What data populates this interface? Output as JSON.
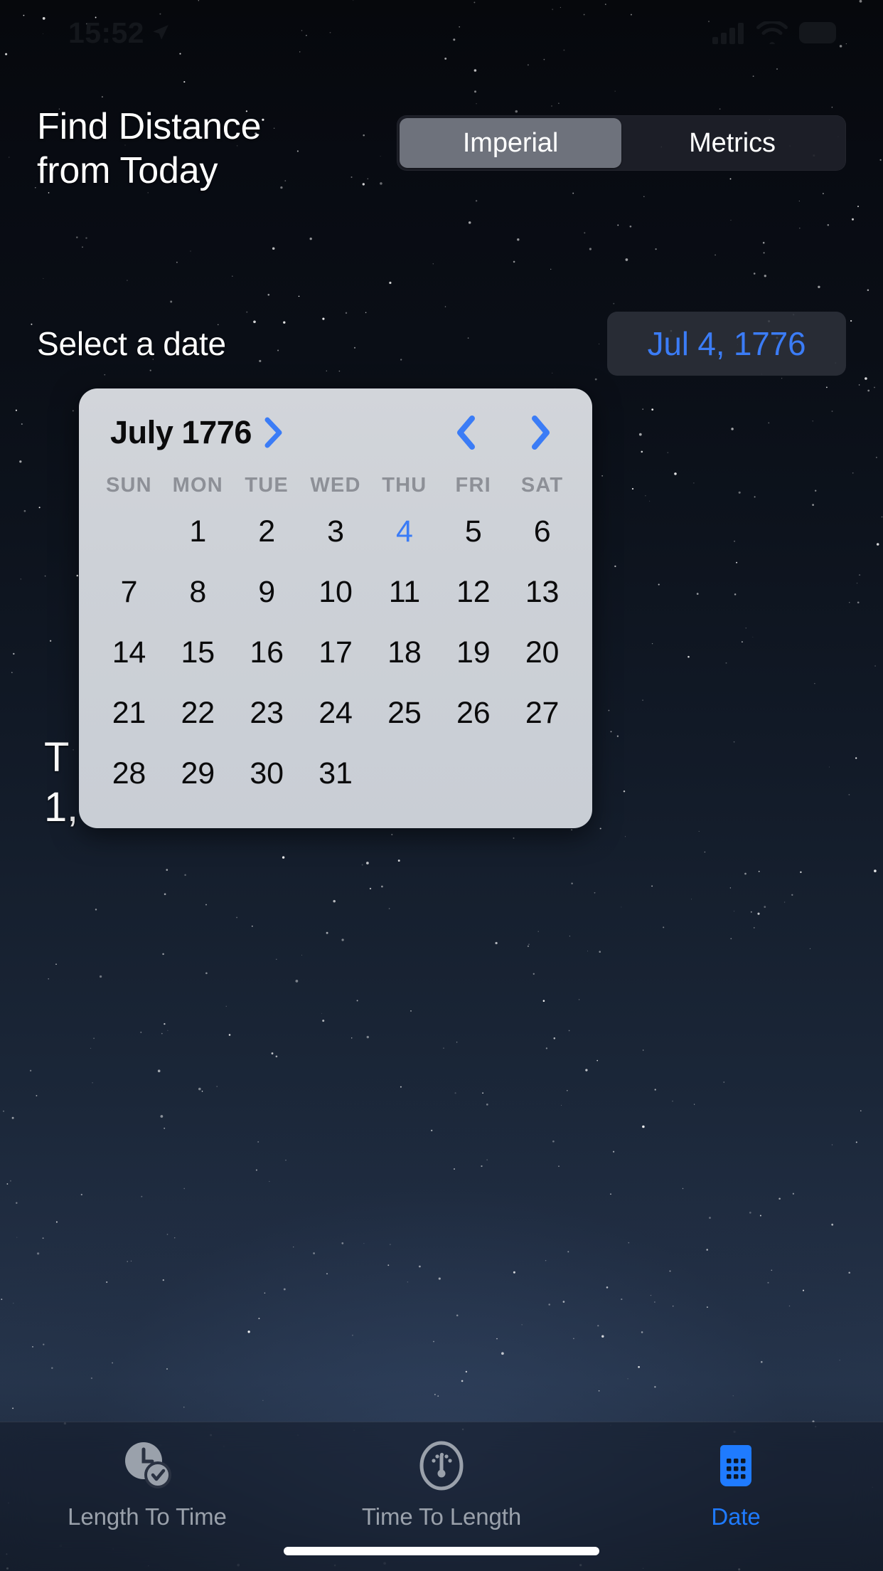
{
  "status_bar": {
    "time": "15:52",
    "location_icon": "location-arrow-icon",
    "cellular_icon": "cellular-signal-icon",
    "wifi_icon": "wifi-icon",
    "battery_icon": "battery-icon"
  },
  "header": {
    "title": "Find Distance from Today",
    "units": {
      "options": [
        "Imperial",
        "Metrics"
      ],
      "selected": "Imperial"
    }
  },
  "date_field": {
    "label": "Select a date",
    "value": "Jul 4, 1776"
  },
  "result": {
    "line1": "T",
    "line2": "1,"
  },
  "calendar": {
    "month_label": "July 1776",
    "month_expand_icon": "chevron-right-icon",
    "prev_icon": "chevron-left-icon",
    "next_icon": "chevron-right-icon",
    "weekdays": [
      "SUN",
      "MON",
      "TUE",
      "WED",
      "THU",
      "FRI",
      "SAT"
    ],
    "leading_blanks": 1,
    "days": [
      1,
      2,
      3,
      4,
      5,
      6,
      7,
      8,
      9,
      10,
      11,
      12,
      13,
      14,
      15,
      16,
      17,
      18,
      19,
      20,
      21,
      22,
      23,
      24,
      25,
      26,
      27,
      28,
      29,
      30,
      31
    ],
    "selected_day": 4,
    "colors": {
      "card_background": "#cdd1d7",
      "selected_circle": "#b4cbe8",
      "accent": "#3b7cf6",
      "weekday_text": "#8d9097"
    }
  },
  "tab_bar": {
    "tabs": [
      {
        "label": "Length To Time",
        "icon": "clock-check-icon",
        "active": false
      },
      {
        "label": "Time To Length",
        "icon": "gauge-icon",
        "active": false
      },
      {
        "label": "Date",
        "icon": "calendar-icon",
        "active": true
      }
    ],
    "active_color": "#1f7bff",
    "inactive_color": "#9aa1ab"
  }
}
